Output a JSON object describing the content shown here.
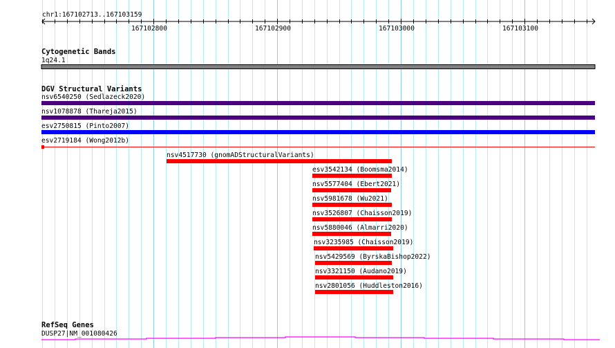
{
  "ruler": {
    "location": "chr1:167102713..167103159",
    "ticks": [
      "167102800",
      "167102900",
      "167103000",
      "167103100"
    ]
  },
  "tracks": {
    "cytobands": {
      "title": "Cytogenetic Bands",
      "feature_label": "1q24.1",
      "color": "#808080"
    },
    "dgv": {
      "title": "DGV Structural Variants",
      "features": [
        {
          "label": "nsv6540250 (Sedlazeck2020)",
          "color": "#4b0082"
        },
        {
          "label": "nsv1078878 (Thareja2015)",
          "color": "#4b0082"
        },
        {
          "label": "esv2750815 (Pinto2007)",
          "color": "#0000ff"
        },
        {
          "label": "esv2719184 (Wong2012b)",
          "color": "#ff0000"
        },
        {
          "label": "nsv4517730 (gnomADStructuralVariants)",
          "color": "#ff0000"
        },
        {
          "label": "esv3542134 (Boomsma2014)",
          "color": "#ff0000"
        },
        {
          "label": "nsv5577404 (Ebert2021)",
          "color": "#ff0000"
        },
        {
          "label": "nsv5981678 (Wu2021)",
          "color": "#ff0000"
        },
        {
          "label": "nsv3526807 (Chaisson2019)",
          "color": "#ff0000"
        },
        {
          "label": "nsv5880046 (Almarri2020)",
          "color": "#ff0000"
        },
        {
          "label": "nsv3235985 (Chaisson2019)",
          "color": "#ff0000"
        },
        {
          "label": "nsv5429569 (ByrskaBishop2022)",
          "color": "#ff0000"
        },
        {
          "label": "nsv3321150 (Audano2019)",
          "color": "#ff0000"
        },
        {
          "label": "nsv2801056 (Huddleston2016)",
          "color": "#ff0000"
        }
      ]
    },
    "refseq": {
      "title": "RefSeq Genes",
      "feature_label": "DUSP27|NM_001080426",
      "color": "#ff00ff"
    }
  }
}
